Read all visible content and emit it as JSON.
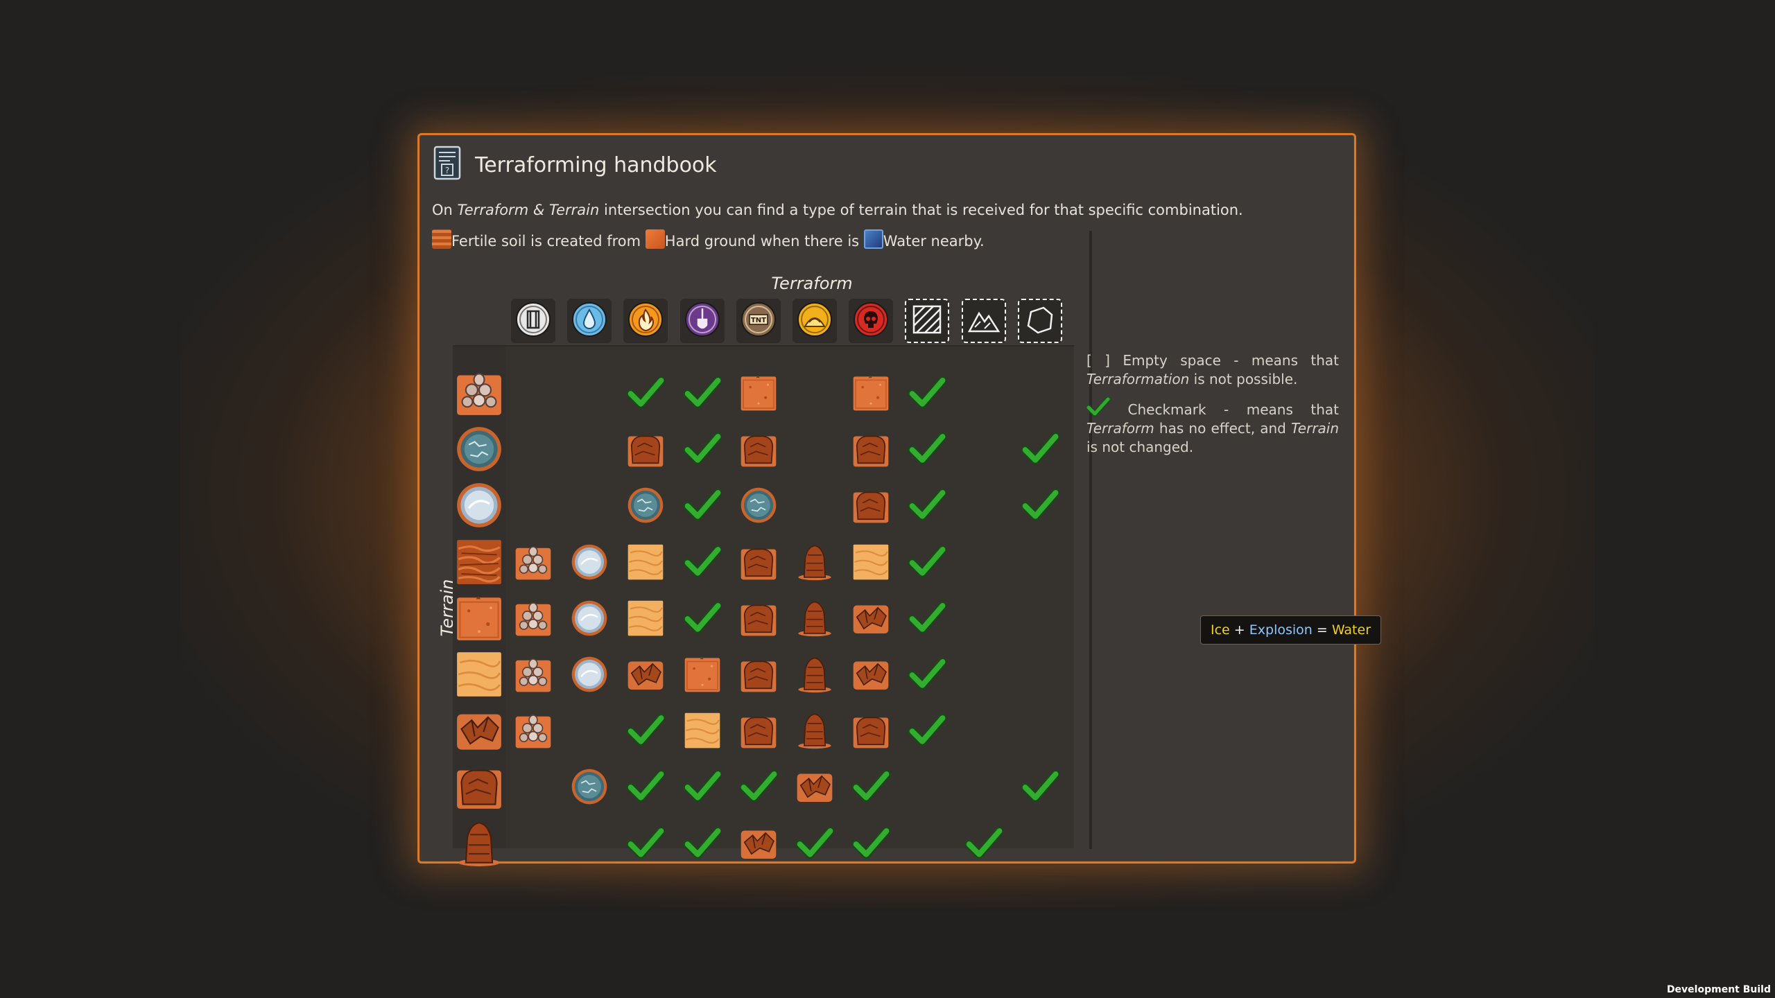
{
  "window": {
    "title": "Terraforming handbook"
  },
  "intro": {
    "on": "On",
    "pair": "Terraform & Terrain",
    "rest": "intersection you can find a type of terrain that is received for that specific combination.",
    "fertile": "Fertile soil is created from",
    "hard": "Hard ground when there is",
    "water": "Water nearby."
  },
  "axes": {
    "terraform": "Terraform",
    "terrain": "Terrain"
  },
  "terraforms": [
    {
      "name": "ice-crystal",
      "icon": "ice-crystal-icon",
      "bg": "#e8e8e8",
      "fg": "#2a2a2a",
      "dashed": false
    },
    {
      "name": "water-drop",
      "icon": "water-drop-icon",
      "bg": "#6bbbe8",
      "fg": "#1e4f74",
      "dashed": false
    },
    {
      "name": "fire",
      "icon": "fire-icon",
      "bg": "#f39a1e",
      "fg": "#7a2a00",
      "dashed": false
    },
    {
      "name": "shovel",
      "icon": "shovel-icon",
      "bg": "#6b3a8c",
      "fg": "#f1eaf6",
      "dashed": false
    },
    {
      "name": "explosion",
      "icon": "tnt-icon",
      "bg": "#8a6a4c",
      "fg": "#fff3d4",
      "dashed": false
    },
    {
      "name": "sand",
      "icon": "sand-pile-icon",
      "bg": "#f2b01a",
      "fg": "#5a3a00",
      "dashed": false
    },
    {
      "name": "skull",
      "icon": "skull-icon",
      "bg": "#d62a22",
      "fg": "#2a0a08",
      "dashed": false
    },
    {
      "name": "flatten",
      "icon": "hatch-icon",
      "bg": "#2b2926",
      "fg": "#f2f2f2",
      "dashed": true
    },
    {
      "name": "mountain",
      "icon": "mountain-icon",
      "bg": "#2b2926",
      "fg": "#f2f2f2",
      "dashed": true
    },
    {
      "name": "rock",
      "icon": "rock-outline-icon",
      "bg": "#2b2926",
      "fg": "#f2f2f2",
      "dashed": true
    }
  ],
  "terrains": [
    "rocky-pebbles",
    "ice-sheet",
    "frozen-lake",
    "fertile-soil",
    "hard-ground",
    "sand",
    "cracked-rock",
    "cliff-boulder",
    "rock-pillar"
  ],
  "grid": [
    [
      "",
      "",
      "check",
      "check",
      "hard-ground",
      "",
      "hard-ground",
      "check",
      "",
      ""
    ],
    [
      "",
      "",
      "cliff-boulder",
      "check",
      "cliff-boulder",
      "",
      "cliff-boulder",
      "check",
      "",
      "check"
    ],
    [
      "",
      "",
      "ice-sheet",
      "check",
      "ice-sheet",
      "",
      "cliff-boulder",
      "check",
      "",
      "check"
    ],
    [
      "rocky-pebbles",
      "frozen-lake",
      "sand",
      "check",
      "cliff-boulder",
      "rock-pillar",
      "sand",
      "check",
      "",
      ""
    ],
    [
      "rocky-pebbles",
      "frozen-lake",
      "sand",
      "check",
      "cliff-boulder",
      "rock-pillar",
      "cracked-rock",
      "check",
      "",
      ""
    ],
    [
      "rocky-pebbles",
      "frozen-lake",
      "cracked-rock",
      "hard-ground",
      "cliff-boulder",
      "rock-pillar",
      "cracked-rock",
      "check",
      "",
      ""
    ],
    [
      "rocky-pebbles",
      "",
      "check",
      "sand",
      "cliff-boulder",
      "rock-pillar",
      "cliff-boulder",
      "check",
      "",
      ""
    ],
    [
      "",
      "ice-sheet",
      "check",
      "check",
      "check",
      "cracked-rock",
      "check",
      "",
      "",
      "check"
    ],
    [
      "",
      "",
      "check",
      "check",
      "cracked-rock",
      "check",
      "check",
      "",
      "check",
      ""
    ]
  ],
  "legend": {
    "empty_prefix": "[ ]",
    "empty_text": "Empty space - means that",
    "empty_term": "Terraformation",
    "empty_tail": "is not possible.",
    "check_text": "Checkmark - means that",
    "check_term": "Terraform",
    "check_mid": "has no effect, and",
    "check_term2": "Terrain",
    "check_tail": "is not changed."
  },
  "tooltip": {
    "a": "Ice",
    "plus": "+",
    "b": "Explosion",
    "eq": "=",
    "c": "Water"
  },
  "footer": {
    "build": "Development Build"
  },
  "colors": {
    "accent_border": "#d9792b",
    "panel_bg": "#3c3936",
    "check": "#31a82f"
  }
}
